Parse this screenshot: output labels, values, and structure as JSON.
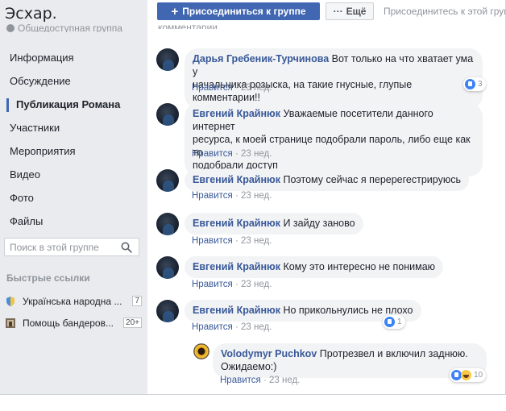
{
  "group": {
    "title": "Эсхар.",
    "type": "Общедоступная группа"
  },
  "nav": [
    {
      "label": "Информация"
    },
    {
      "label": "Обсуждение"
    },
    {
      "label": "Публикация Романа"
    },
    {
      "label": "Участники"
    },
    {
      "label": "Мероприятия"
    },
    {
      "label": "Видео"
    },
    {
      "label": "Фото"
    },
    {
      "label": "Файлы"
    }
  ],
  "search": {
    "placeholder": "Поиск в этой группе"
  },
  "quick_links": {
    "title": "Быстрые ссылки",
    "items": [
      {
        "label": "Українська народна ...",
        "count": "7"
      },
      {
        "label": "Помощь бандеров...",
        "count": "20+"
      }
    ]
  },
  "topbar": {
    "join_label": "Присоединиться к группе",
    "more_label": "Ещё",
    "hint": "Присоединитесь к этой группе",
    "cut_text": "комментарии"
  },
  "comments": [
    {
      "author": "Дарья Гребеник-Турчинова",
      "line1": "Вот только на что хватает ума у",
      "line2": "начальника розыска, на такие гнусные, глупые комментарии!!",
      "like": "Нравится",
      "time": "23 нед.",
      "reactions": "3"
    },
    {
      "author": "Евгений Крайнюк",
      "line1": "Уважаемые посетители данного интернет",
      "line2": "ресурса, к моей странице подобрали пароль, либо еще как то",
      "line3": "подобрали доступ",
      "like": "Нравится",
      "time": "23 нед."
    },
    {
      "author": "Евгений Крайнюк",
      "line1": "Поэтому сейчас я перерегестрируюсь",
      "like": "Нравится",
      "time": "23 нед."
    },
    {
      "author": "Евгений Крайнюк",
      "line1": "И зайду заново",
      "like": "Нравится",
      "time": "23 нед."
    },
    {
      "author": "Евгений Крайнюк",
      "line1": "Кому это интересно не понимаю",
      "like": "Нравится",
      "time": "23 нед."
    },
    {
      "author": "Евгений Крайнюк",
      "line1": "Но прикольнулись не плохо",
      "like": "Нравится",
      "time": "23 нед.",
      "reactions": "1"
    }
  ],
  "reply": {
    "author": "Volodymyr Puchkov",
    "line1": "Протрезвел и включил заднюю.",
    "line2": "Ожидаемо:)",
    "like": "Нравится",
    "time": "23 нед.",
    "reactions": "10"
  },
  "colors": {
    "brand": "#4267b2",
    "link": "#385898",
    "sidebar_bg": "#e9ebee",
    "bubble_bg": "#f2f3f5",
    "muted": "#90949c"
  }
}
